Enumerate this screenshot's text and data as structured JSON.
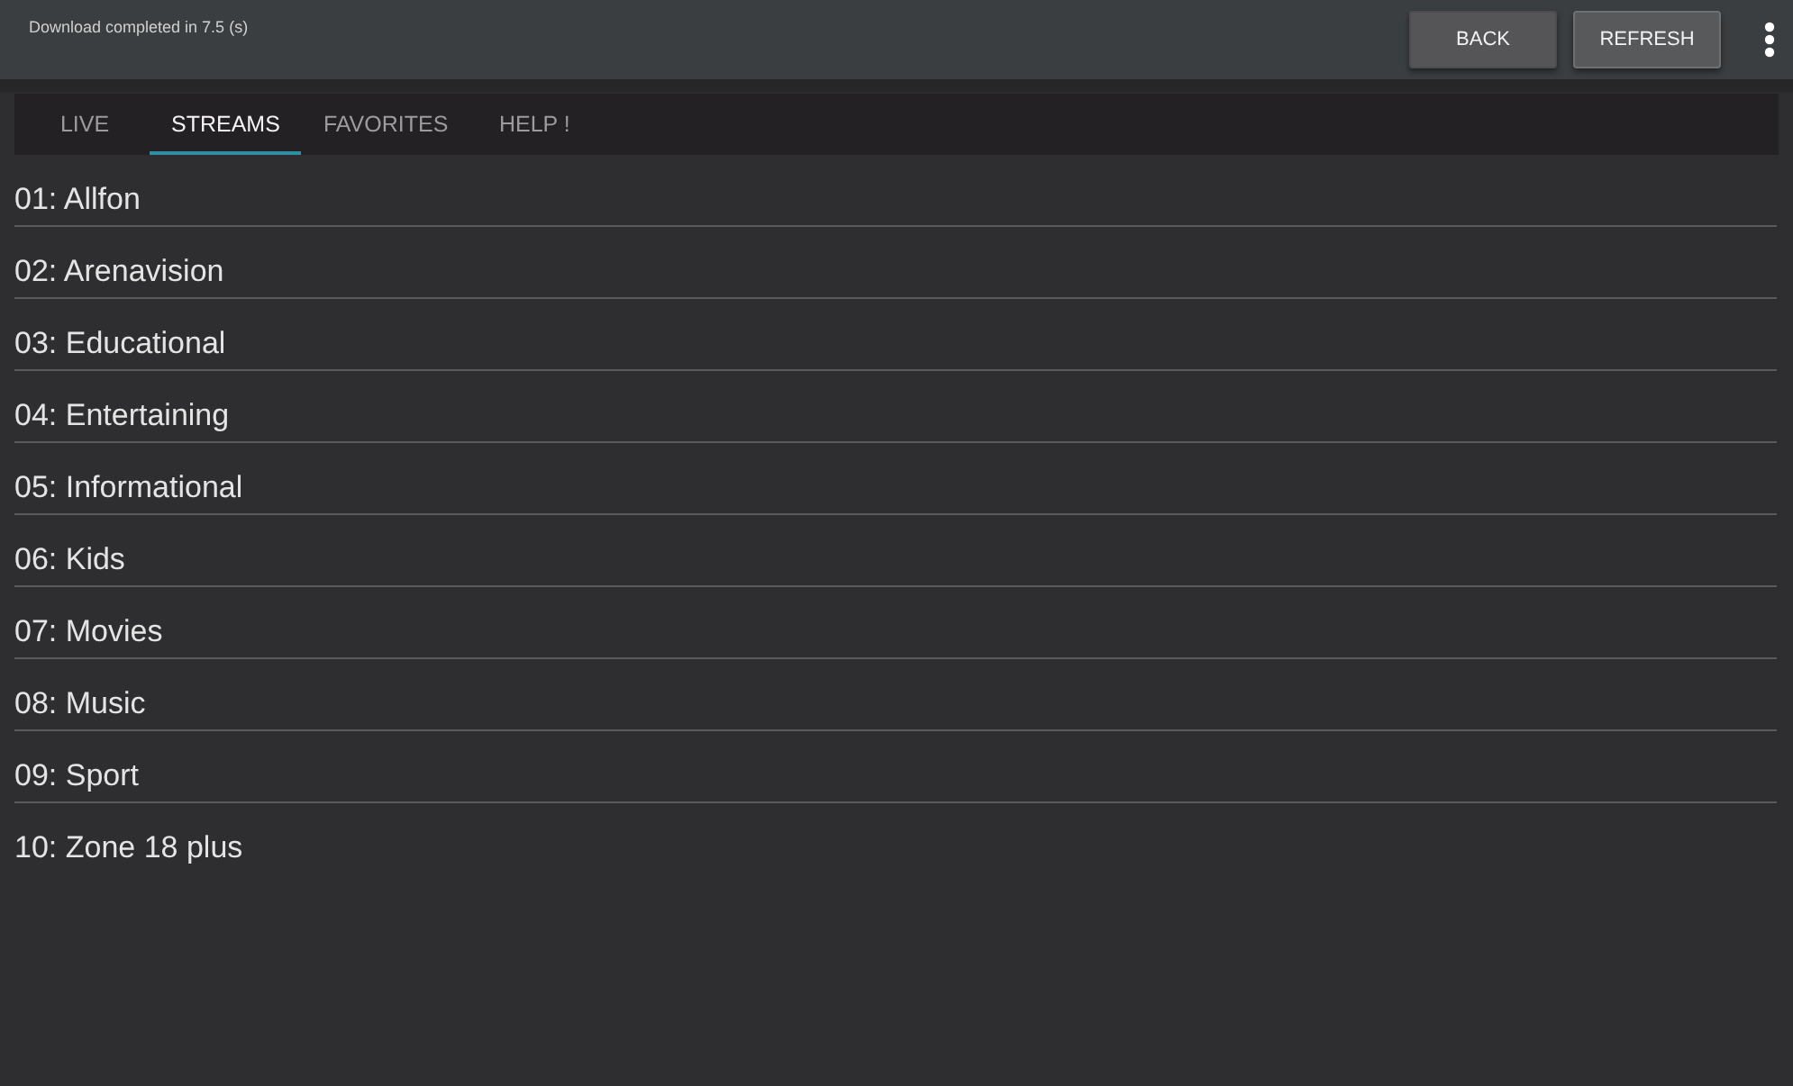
{
  "status_bar": {
    "message": "Download completed in 7.5 (s)"
  },
  "toolbar": {
    "buttons": [
      {
        "label": "BACK",
        "focused": false
      },
      {
        "label": "REFRESH",
        "focused": true
      }
    ]
  },
  "tabs": [
    {
      "label": "LIVE",
      "selected": false
    },
    {
      "label": "STREAMS",
      "selected": true
    },
    {
      "label": "FAVORITES",
      "selected": false
    },
    {
      "label": "HELP !",
      "selected": false
    }
  ],
  "list": {
    "items": [
      {
        "label": "01: Allfon"
      },
      {
        "label": "02: Arenavision"
      },
      {
        "label": "03: Educational"
      },
      {
        "label": "04: Entertaining"
      },
      {
        "label": "05: Informational"
      },
      {
        "label": "06: Kids"
      },
      {
        "label": "07: Movies"
      },
      {
        "label": "08: Music"
      },
      {
        "label": "09: Sport"
      },
      {
        "label": "10: Zone 18 plus"
      }
    ]
  }
}
